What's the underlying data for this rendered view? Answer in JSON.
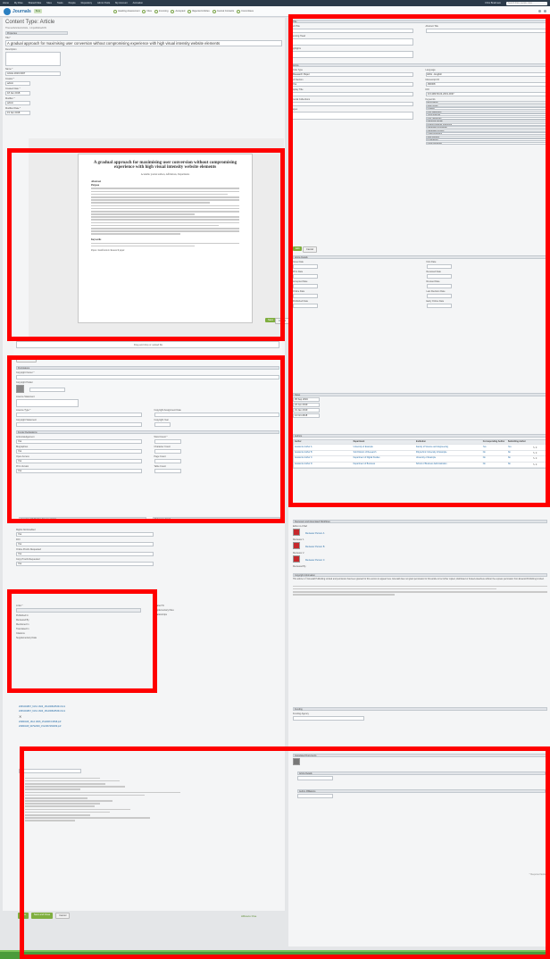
{
  "topbar": {
    "items": [
      "Home",
      "My Files",
      "Shared Files",
      "Sites",
      "Tasks",
      "People",
      "Repository",
      "Admin Tools",
      "My Account",
      "Animation"
    ],
    "user": "Chris Bradmam",
    "search_placeholder": "Search Files, people, sites"
  },
  "app": {
    "logo": "Journals",
    "badge": "Beta",
    "filters": [
      "Awaiting Assessment",
      "Files",
      "Incoming",
      "Accepted",
      "Rejected Articles",
      "Journal Contacts",
      "Committees"
    ]
  },
  "left": {
    "content_type": "Content Type: Article",
    "breadcrumb": "Theme/Articles/Article - UnpublishedUN",
    "title_label": "Title*",
    "title_value": "A gradual approach for maximising user conversion without compromising experience with high visual intensity website elements",
    "fields": [
      {
        "label": "Description",
        "value": ""
      },
      {
        "label": "Name *",
        "value": "Article 2019 0037"
      },
      {
        "label": "Creator *",
        "value": "admin"
      },
      {
        "label": "Created Date *",
        "value": "18 Jan 2018"
      },
      {
        "label": "Modifier *",
        "value": "admin"
      },
      {
        "label": "Modified Date *",
        "value": "19 Jan 2018"
      }
    ],
    "doc": {
      "title": "A gradual approach for maximising user conversion without compromising experience with high visual intensity website elements",
      "authors": "Academic journal authors, Affiliations, Departments",
      "abstract": "Abstract",
      "purpose": "Purpose",
      "keywords": "Keywords",
      "classification": "Paper classification: Research paper"
    },
    "preview_buttons": [
      "Save",
      "Cancel"
    ],
    "drop_label": "Drag and drop or upload file",
    "browse": "Browse a file",
    "sections": [
      {
        "title": "Permissions",
        "fields": [
          "Copyright Owner *",
          "Copyright Holder",
          "Licence Statement",
          "Licence Type *",
          "Copyright Assignment Date",
          "Copyright Statement",
          "Copyright Year"
        ]
      },
      {
        "title": "Funder Declarations",
        "fields": [
          "Acknowledgement",
          "Word Count *",
          "Biographies",
          "Character Count",
          "Open Access",
          "Page Count",
          "Print Version",
          "Table Count"
        ]
      }
    ],
    "funder_value": "Yes",
    "assoc": "Associated Publishing Documentation",
    "referrals": "Reference Count",
    "reviews": [
      "Rights Not Enabled",
      "Yes",
      "DOI",
      "Online Proofs Requested",
      "Copy Proofs Requested"
    ],
    "list_labels": [
      "Links *",
      "Related To",
      "Published In",
      "Reviewed By",
      "Mentioned In",
      "Translated In",
      "Citations",
      "Supplementary Data",
      "Supplementary Files",
      "Relationships"
    ],
    "files": [
      "2083494867_6161 1606_1512968185364.html",
      "2083494867_6161 1606_1512968185364.html",
      "20980408_1614 1808_1512968 19598.pdf",
      "20980408_90792693_1512967269389.pdf"
    ]
  },
  "right": {
    "title": "Title",
    "sections": [
      "Article",
      "Article Details",
      "Dates",
      "Authors",
      "Author Affiliations",
      "Reviewers and Associated Workflows",
      "Copyright Information",
      "Funding",
      "Associated Documents"
    ],
    "fields": [
      "Sub Title",
      "Running Head",
      "Abstract Title",
      "Highlights",
      "Article Type",
      "Sub Section",
      "Display Title",
      "Special Collections",
      "Language",
      "Manuscript ID",
      "Submission ID",
      "DOI",
      "Article Version",
      "Pages",
      "Keywords",
      "Acknowledgements",
      "Special Classifications"
    ],
    "keywords": [
      "Accessibility",
      "Web Design",
      "Usability",
      "User experience",
      "Visual intensity",
      "User conversion",
      "Interaction design",
      "Human-computer interaction",
      "Information technology",
      "Information science",
      "Online behaviour",
      "Web analytics",
      "E-commerce",
      "Digital marketing"
    ],
    "article_type": "Research Paper",
    "sub_section": "Yes",
    "language": "ENG - English",
    "manuscript_id": "JD0008",
    "doi": "10.1108/JD-04-2019-0037",
    "authors": [
      {
        "name": "Academic Author A",
        "dept": "University of Example",
        "inst": "Faculty of Science and Engineering",
        "corr": "Yes"
      },
      {
        "name": "Academic Author B",
        "dept": "Sub Division of Research",
        "inst": "Polytechnic University of Example",
        "corr": "No"
      },
      {
        "name": "Academic Author C",
        "dept": "Department of Digital Studies",
        "inst": "University of Example",
        "corr": "No"
      },
      {
        "name": "Academic Author D",
        "dept": "Department of Business",
        "inst": "School of Business Administration",
        "corr": "No"
      }
    ],
    "author_headers": [
      "Author",
      "Department",
      "Institution",
      "Corresponding Author",
      "Submitting Author",
      ""
    ],
    "buttons": [
      "Edit",
      "Cancel"
    ],
    "date_labels": [
      "Issue Date",
      "First Date",
      "Print Date",
      "Received Date",
      "Accepted Date",
      "Revised Date",
      "Online Date",
      "Last Revision Date",
      "Published Date",
      "Early Online Date"
    ],
    "dates": [
      "05 Sep 2019",
      "24 Jun 2019",
      "31 Jan 2019",
      "12 Oct 2018"
    ],
    "reviewer_labels": [
      "Editor-in-Chief",
      "Reviewer 1",
      "Reviewer 2",
      "Reviewed By"
    ],
    "reviewer_names": [
      "Reviewer Person A",
      "Reviewer Person B",
      "Reviewer Person C"
    ],
    "copyright_text": "This article is © Emerald Publishing Limited and permission has been granted for this version to appear here. Emerald does not grant permission for this article to be further copied, distributed or hosted elsewhere without the express permission from Emerald Publishing Limited.",
    "funding_label": "Funding Agency",
    "footer_note": "* Required fields"
  },
  "bottom": {
    "buttons": [
      "Save",
      "Save and Close",
      "Cancel"
    ],
    "alfresco": "Alfresco One"
  }
}
